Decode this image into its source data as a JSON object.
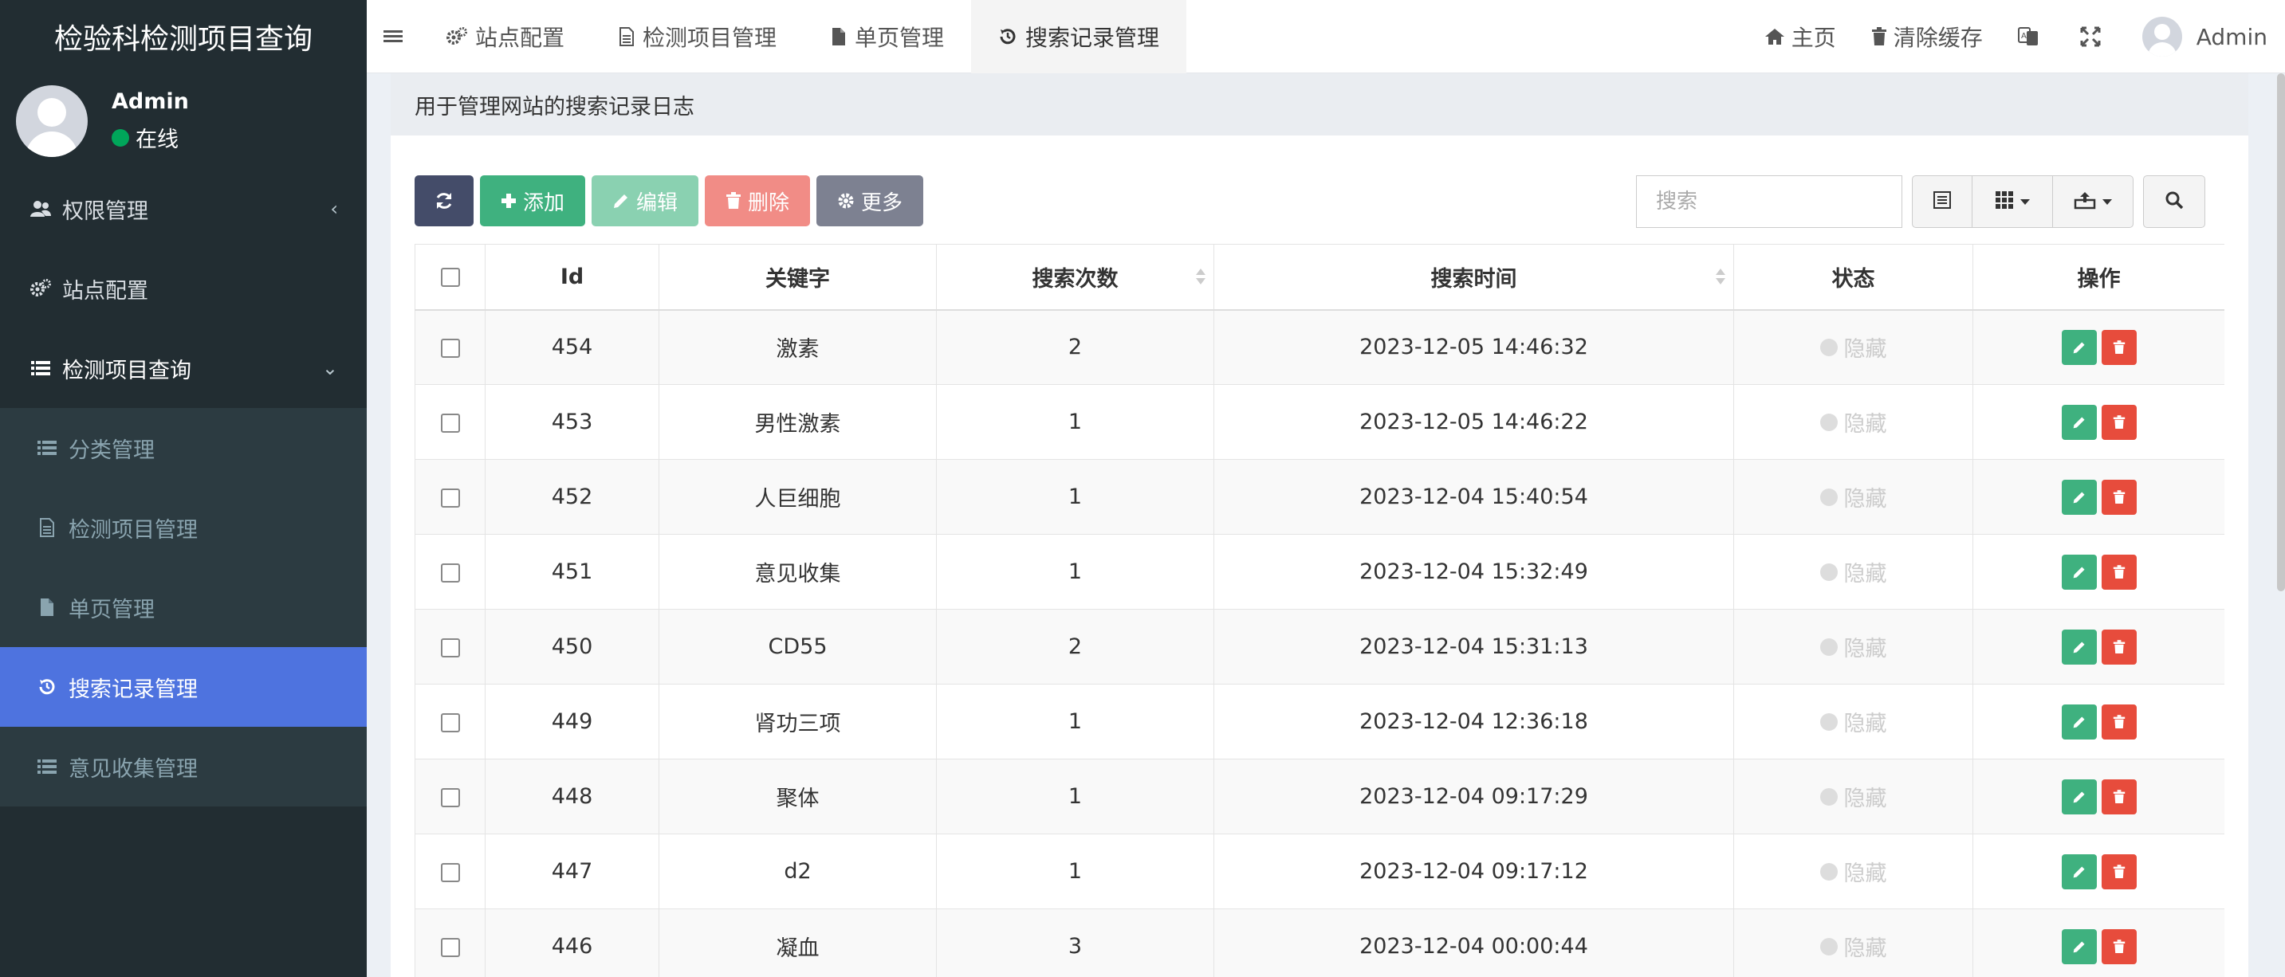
{
  "sidebar": {
    "brand": "检验科检测项目查询",
    "user": {
      "name": "Admin",
      "status": "在线"
    },
    "nav": {
      "auth": "权限管理",
      "site": "站点配置",
      "project_query": "检测项目查询"
    },
    "subnav": {
      "category": "分类管理",
      "item": "检测项目管理",
      "page": "单页管理",
      "search": "搜索记录管理",
      "feedback": "意见收集管理"
    }
  },
  "topnav": {
    "tabs": {
      "site": "站点配置",
      "item": "检测项目管理",
      "page": "单页管理",
      "search": "搜索记录管理"
    },
    "home": "主页",
    "clear_cache": "清除缓存",
    "user": "Admin"
  },
  "content": {
    "description": "用于管理网站的搜索记录日志",
    "toolbar": {
      "add": "添加",
      "edit": "编辑",
      "delete": "删除",
      "more": "更多",
      "search_placeholder": "搜索"
    },
    "table": {
      "headers": {
        "id": "Id",
        "keyword": "关键字",
        "count": "搜索次数",
        "time": "搜索时间",
        "status": "状态",
        "op": "操作"
      },
      "rows": [
        {
          "id": "454",
          "keyword": "激素",
          "count": "2",
          "time": "2023-12-05 14:46:32",
          "status": "隐藏"
        },
        {
          "id": "453",
          "keyword": "男性激素",
          "count": "1",
          "time": "2023-12-05 14:46:22",
          "status": "隐藏"
        },
        {
          "id": "452",
          "keyword": "人巨细胞",
          "count": "1",
          "time": "2023-12-04 15:40:54",
          "status": "隐藏"
        },
        {
          "id": "451",
          "keyword": "意见收集",
          "count": "1",
          "time": "2023-12-04 15:32:49",
          "status": "隐藏"
        },
        {
          "id": "450",
          "keyword": "CD55",
          "count": "2",
          "time": "2023-12-04 15:31:13",
          "status": "隐藏"
        },
        {
          "id": "449",
          "keyword": "肾功三项",
          "count": "1",
          "time": "2023-12-04 12:36:18",
          "status": "隐藏"
        },
        {
          "id": "448",
          "keyword": "聚体",
          "count": "1",
          "time": "2023-12-04 09:17:29",
          "status": "隐藏"
        },
        {
          "id": "447",
          "keyword": "d2",
          "count": "1",
          "time": "2023-12-04 09:17:12",
          "status": "隐藏"
        },
        {
          "id": "446",
          "keyword": "凝血",
          "count": "3",
          "time": "2023-12-04 00:00:44",
          "status": "隐藏"
        }
      ]
    }
  }
}
